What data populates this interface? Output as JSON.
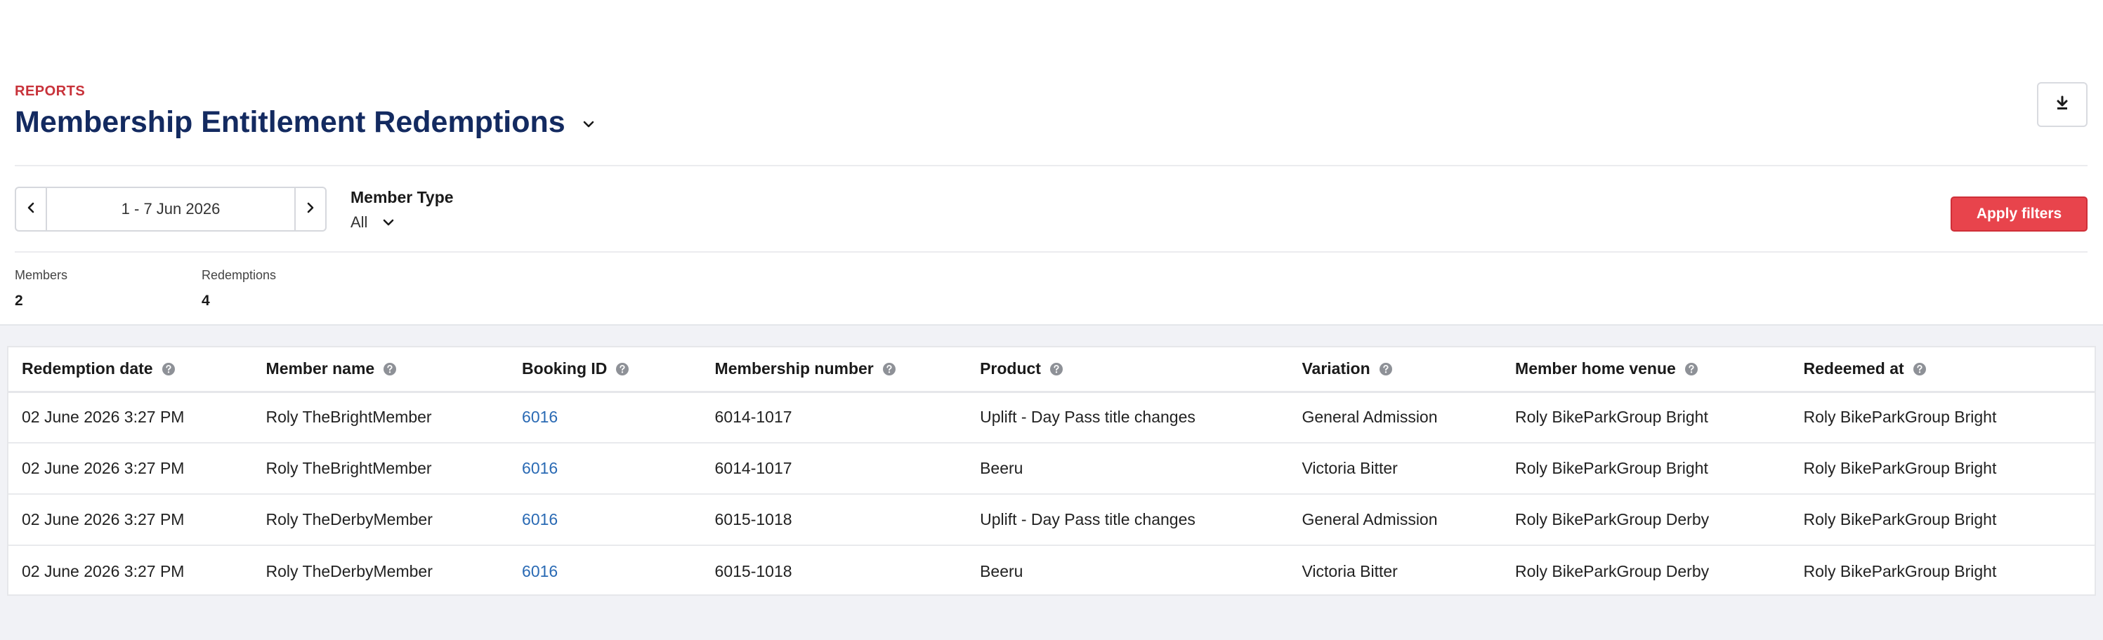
{
  "header": {
    "section": "REPORTS",
    "title": "Membership Entitlement Redemptions"
  },
  "filters": {
    "date_range": "1 - 7 Jun 2026",
    "member_type_label": "Member Type",
    "member_type_value": "All",
    "apply_label": "Apply filters"
  },
  "stats": {
    "members_label": "Members",
    "members_value": "2",
    "redemptions_label": "Redemptions",
    "redemptions_value": "4"
  },
  "table": {
    "columns": [
      "Redemption date",
      "Member name",
      "Booking ID",
      "Membership number",
      "Product",
      "Variation",
      "Member home venue",
      "Redeemed at"
    ],
    "rows": [
      [
        "02 June 2026 3:27 PM",
        "Roly TheBrightMember",
        "6016",
        "6014-1017",
        "Uplift - Day Pass title changes",
        "General Admission",
        "Roly BikeParkGroup Bright",
        "Roly BikeParkGroup Bright"
      ],
      [
        "02 June 2026 3:27 PM",
        "Roly TheBrightMember",
        "6016",
        "6014-1017",
        "Beeru",
        "Victoria Bitter",
        "Roly BikeParkGroup Bright",
        "Roly BikeParkGroup Bright"
      ],
      [
        "02 June 2026 3:27 PM",
        "Roly TheDerbyMember",
        "6016",
        "6015-1018",
        "Uplift - Day Pass title changes",
        "General Admission",
        "Roly BikeParkGroup Derby",
        "Roly BikeParkGroup Bright"
      ],
      [
        "02 June 2026 3:27 PM",
        "Roly TheDerbyMember",
        "6016",
        "6015-1018",
        "Beeru",
        "Victoria Bitter",
        "Roly BikeParkGroup Derby",
        "Roly BikeParkGroup Bright"
      ]
    ]
  },
  "icons": {
    "title_dropdown": "chevron-down-icon",
    "download": "download-icon",
    "prev": "chevron-left-icon",
    "next": "chevron-right-icon",
    "help": "question-circle-icon"
  },
  "colors": {
    "accent_red": "#e8444c",
    "title_navy": "#132a60",
    "link_blue": "#2a6ab4",
    "section_red": "#c8323a"
  }
}
